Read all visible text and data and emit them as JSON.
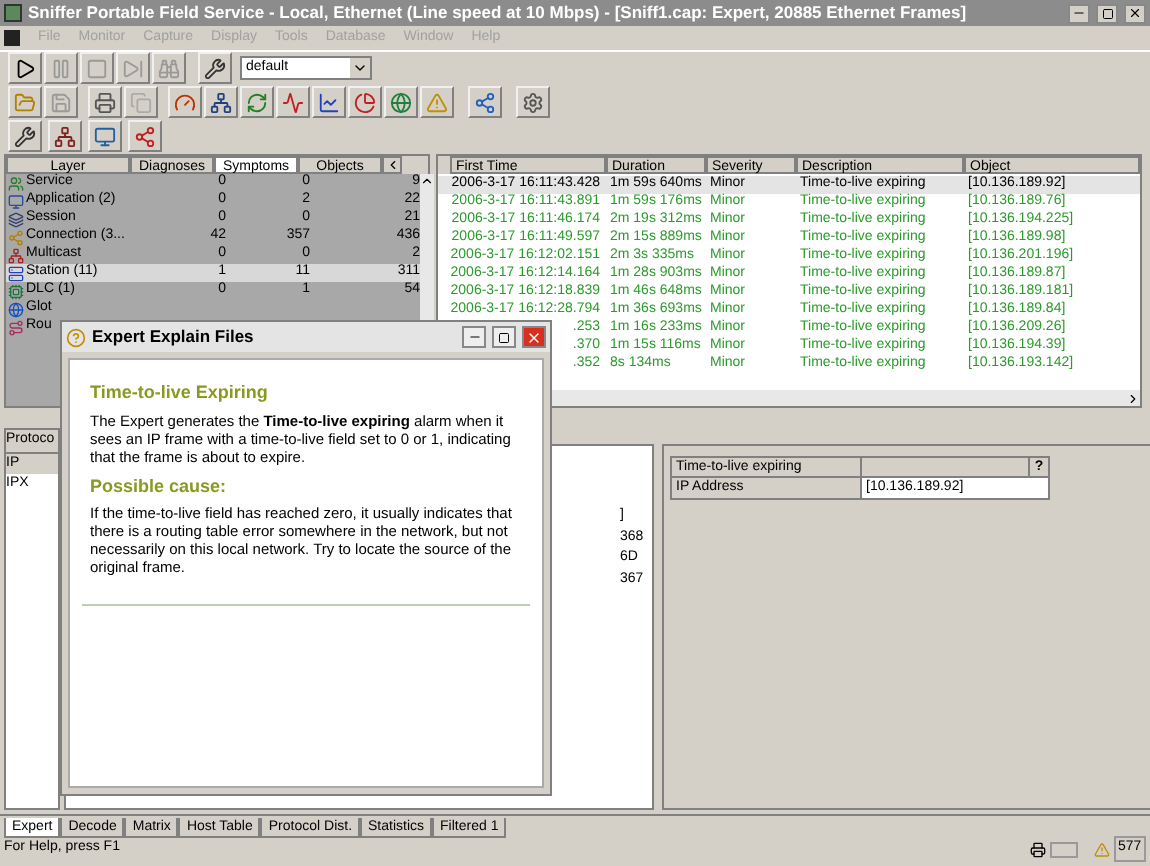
{
  "window": {
    "title": "Sniffer Portable Field Service - Local, Ethernet (Line speed at 10 Mbps) - [Sniff1.cap: Expert, 20885 Ethernet Frames]"
  },
  "menu": [
    "File",
    "Monitor",
    "Capture",
    "Display",
    "Tools",
    "Database",
    "Window",
    "Help"
  ],
  "toolbar": {
    "profile": "default"
  },
  "layer_panel": {
    "tabs": [
      {
        "label": "Layer",
        "selected": false
      },
      {
        "label": "Diagnoses",
        "selected": false
      },
      {
        "label": "Symptoms",
        "selected": true
      },
      {
        "label": "Objects",
        "selected": false
      }
    ],
    "rows": [
      {
        "kind": "service",
        "name": "Service",
        "diagnoses": "0",
        "symptoms": "0",
        "objects": "9",
        "selected": false
      },
      {
        "kind": "application",
        "name": "Application (2)",
        "diagnoses": "0",
        "symptoms": "2",
        "objects": "22",
        "selected": false
      },
      {
        "kind": "session",
        "name": "Session",
        "diagnoses": "0",
        "symptoms": "0",
        "objects": "21",
        "selected": false
      },
      {
        "kind": "connection",
        "name": "Connection (3...",
        "diagnoses": "42",
        "symptoms": "357",
        "objects": "436",
        "selected": false
      },
      {
        "kind": "multicast",
        "name": "Multicast",
        "diagnoses": "0",
        "symptoms": "0",
        "objects": "2",
        "selected": false
      },
      {
        "kind": "station",
        "name": "Station (11)",
        "diagnoses": "1",
        "symptoms": "11",
        "objects": "311",
        "selected": true
      },
      {
        "kind": "dlc",
        "name": "DLC (1)",
        "diagnoses": "0",
        "symptoms": "1",
        "objects": "54",
        "selected": false
      },
      {
        "kind": "global",
        "name": "Glot",
        "selected": false
      },
      {
        "kind": "route",
        "name": "Rou",
        "selected": false
      }
    ]
  },
  "event_table": {
    "columns": [
      "First Time",
      "Duration",
      "Severity",
      "Description",
      "Object"
    ],
    "rows": [
      {
        "first_time": "2006-3-17 16:11:43.428",
        "duration": "1m 59s 640ms",
        "severity": "Minor",
        "description": "Time-to-live expiring",
        "object": "[10.136.189.92]",
        "selected": true
      },
      {
        "first_time": "2006-3-17 16:11:43.891",
        "duration": "1m 59s 176ms",
        "severity": "Minor",
        "description": "Time-to-live expiring",
        "object": "[10.136.189.76]",
        "selected": false
      },
      {
        "first_time": "2006-3-17 16:11:46.174",
        "duration": "2m 19s 312ms",
        "severity": "Minor",
        "description": "Time-to-live expiring",
        "object": "[10.136.194.225]",
        "selected": false
      },
      {
        "first_time": "2006-3-17 16:11:49.597",
        "duration": "2m 15s 889ms",
        "severity": "Minor",
        "description": "Time-to-live expiring",
        "object": "[10.136.189.98]",
        "selected": false
      },
      {
        "first_time": "2006-3-17 16:12:02.151",
        "duration": "2m 3s 335ms",
        "severity": "Minor",
        "description": "Time-to-live expiring",
        "object": "[10.136.201.196]",
        "selected": false
      },
      {
        "first_time": "2006-3-17 16:12:14.164",
        "duration": "1m 28s 903ms",
        "severity": "Minor",
        "description": "Time-to-live expiring",
        "object": "[10.136.189.87]",
        "selected": false
      },
      {
        "first_time": "2006-3-17 16:12:18.839",
        "duration": "1m 46s 648ms",
        "severity": "Minor",
        "description": "Time-to-live expiring",
        "object": "[10.136.189.181]",
        "selected": false
      },
      {
        "first_time": "2006-3-17 16:12:28.794",
        "duration": "1m 36s 693ms",
        "severity": "Minor",
        "description": "Time-to-live expiring",
        "object": "[10.136.189.84]",
        "selected": false
      },
      {
        "first_time": ".253",
        "duration": "1m 16s 233ms",
        "severity": "Minor",
        "description": "Time-to-live expiring",
        "object": "[10.136.209.26]",
        "selected": false
      },
      {
        "first_time": ".370",
        "duration": "1m 15s 116ms",
        "severity": "Minor",
        "description": "Time-to-live expiring",
        "object": "[10.136.194.39]",
        "selected": false
      },
      {
        "first_time": ".352",
        "duration": "8s 134ms",
        "severity": "Minor",
        "description": "Time-to-live expiring",
        "object": "[10.136.193.142]",
        "selected": false
      }
    ]
  },
  "protocol_list": {
    "header": "Protoco",
    "items": [
      {
        "label": "IP",
        "selected": true
      },
      {
        "label": "IPX",
        "selected": false
      }
    ]
  },
  "middle_list": {
    "items": [
      "]",
      "368",
      "6D",
      "367"
    ]
  },
  "detail_table": {
    "title": "Time-to-live expiring",
    "help": "?",
    "rows": [
      {
        "label": "IP Address",
        "value": "[10.136.189.92]"
      }
    ]
  },
  "dialog": {
    "title": "Expert Explain Files",
    "heading": "Time-to-live Expiring",
    "body": "The Expert generates the **Time-to-live expiring** alarm when it sees an IP frame with a time-to-live field set to 0 or 1, indicating that the frame is about to expire.",
    "subheading": "Possible cause:",
    "cause": "If the time-to-live field has reached zero, it usually indicates that there is a routing table error somewhere in the network, but not necessarily on this local network. Try to locate the source of the original frame."
  },
  "view_tabs": [
    {
      "label": "Expert",
      "selected": true
    },
    {
      "label": "Decode",
      "selected": false
    },
    {
      "label": "Matrix",
      "selected": false
    },
    {
      "label": "Host Table",
      "selected": false
    },
    {
      "label": "Protocol Dist.",
      "selected": false
    },
    {
      "label": "Statistics",
      "selected": false
    },
    {
      "label": "Filtered 1",
      "selected": false
    }
  ],
  "status_bar": {
    "message": "For Help, press F1",
    "alarm_count": "577"
  }
}
